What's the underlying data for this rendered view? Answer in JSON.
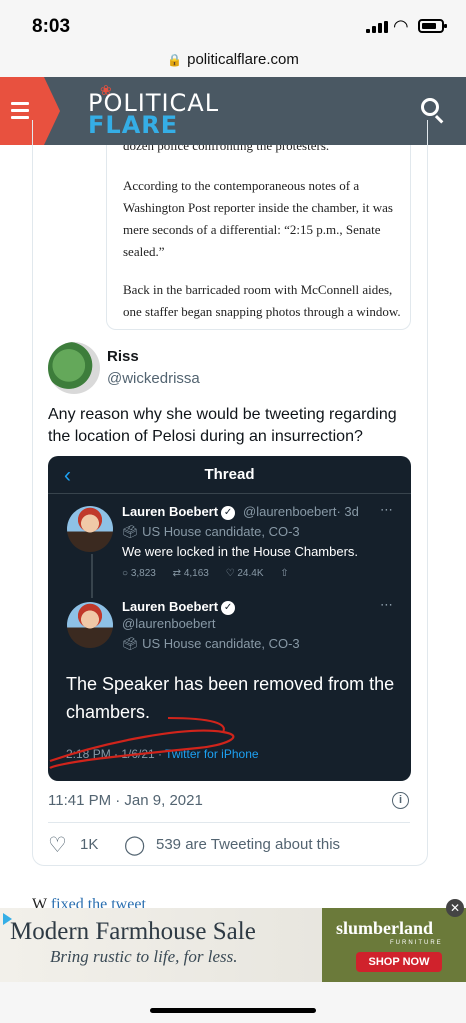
{
  "status_bar": {
    "time": "8:03"
  },
  "browser": {
    "url": "politicalflare.com"
  },
  "site": {
    "logo_line1": "POLITICAL",
    "logo_line2": "FLARE"
  },
  "article": {
    "cut_line": "dozen police confronting the protesters.",
    "para1": "According to the contemporaneous notes of a Washington Post reporter inside the chamber, it was mere seconds of a differential: “2:15 p.m., Senate sealed.”",
    "para2": "Back in the barricaded room with McConnell aides, one staffer began snapping photos through a window. The world was T..."
  },
  "tweet": {
    "author_name": "Riss",
    "author_handle": "@wickedrissa",
    "text": "Any reason why she would be tweeting regarding the location of Pelosi during an insurrection?",
    "timestamp": "11:41 PM · Jan 9, 2021",
    "likes": "1K",
    "tweeting_text": "539 are Tweeting about this"
  },
  "embedded": {
    "header_title": "Thread",
    "tweet1": {
      "name": "Lauren Boebert",
      "handle": "@laurenboebert",
      "time": "· 3d",
      "candidate": "US House candidate, CO-3",
      "text": "We were locked in the House Chambers.",
      "replies": "3,823",
      "retweets": "4,163",
      "likes": "24.4K"
    },
    "tweet2": {
      "name": "Lauren Boebert",
      "handle": "@laurenboebert",
      "candidate": "US House candidate, CO-3",
      "text": "The Speaker has been removed from the chambers.",
      "stamp": "2:18 PM · 1/6/21 · ",
      "source": "Twitter for iPhone"
    }
  },
  "peek": {
    "text_start": "W",
    "link_text": "fixed the tweet"
  },
  "ad": {
    "title": "Modern Farmhouse Sale",
    "subtitle": "Bring rustic to life, for less.",
    "brand": "slumberland",
    "brand_sub": "FURNITURE",
    "cta": "SHOP NOW"
  },
  "colors": {
    "header_bg": "#4a5863",
    "accent_red": "#e8513f",
    "logo_blue": "#35aee6",
    "twitter_blue": "#1da1f2",
    "dark_card": "#15202b"
  },
  "icons": [
    "menu-icon",
    "search-icon",
    "lock-icon",
    "back-chevron-icon",
    "verified-icon",
    "reply-icon",
    "retweet-icon",
    "like-icon",
    "share-icon",
    "info-icon",
    "heart-icon",
    "comment-icon",
    "close-icon"
  ]
}
